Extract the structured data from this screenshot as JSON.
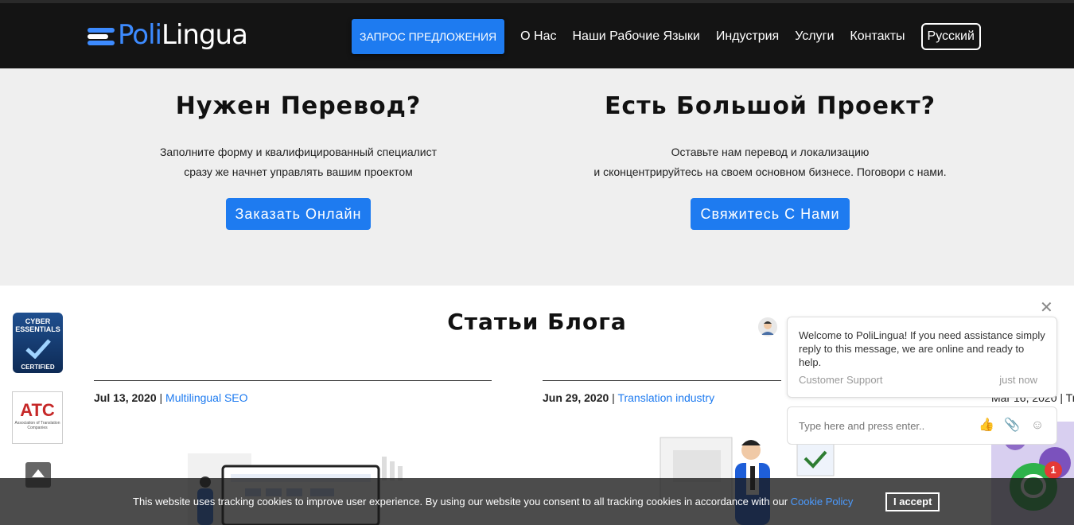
{
  "header": {
    "logo_prefix": "Poli",
    "logo_suffix": "Lingua",
    "cta_label": "ЗАПРОС ПРЕДЛОЖЕНИЯ",
    "nav": [
      "О Нас",
      "Наши Рабочие Языки",
      "Индустрия",
      "Услуги",
      "Контакты"
    ],
    "language": "Русский"
  },
  "hero": {
    "left": {
      "title": "Нужен Перевод?",
      "line1": "Заполните форму и квалифицированный специалист",
      "line2": "сразу же начнет управлять вашим проектом",
      "button": "Заказать Онлайн"
    },
    "right": {
      "title": "Есть Большой Проект?",
      "line1": "Оставьте нам перевод и локализацию",
      "line2": "и сконцентрируйтесь на своем основном бизнесе. Поговори с нами.",
      "button": "Свяжитесь С Нами"
    }
  },
  "blog": {
    "title": "Статьи Блога",
    "posts": [
      {
        "date": "Jul 13, 2020",
        "separator": " | ",
        "category": "Multilingual SEO"
      },
      {
        "date": "Jun 29, 2020",
        "separator": " | ",
        "category": "Translation industry"
      },
      {
        "date": "Mar 16, 2020",
        "separator": " | ",
        "category": "Tra"
      }
    ]
  },
  "badges": {
    "cyber_top": "CYBER",
    "cyber_mid": "ESSENTIALS",
    "cyber_bottom": "CERTIFIED",
    "atc_name": "ATC",
    "atc_sub": "Association of Translation Companies"
  },
  "chat": {
    "message": "Welcome to PoliLingua! If you need assistance simply reply to this message, we are online and ready to help.",
    "sender": "Customer Support",
    "time": "just now",
    "input_placeholder": "Type here and press enter..",
    "unread_count": "1"
  },
  "cookie": {
    "text": "This website uses tracking cookies to improve user experience. By using our website you consent to all tracking cookies in accordance with our ",
    "link": "Cookie Policy",
    "accept": "I accept"
  },
  "colors": {
    "accent": "#1e7bf0",
    "header_bg": "#141414",
    "hero_bg": "#efefef",
    "chat_green": "#2eb24b"
  }
}
